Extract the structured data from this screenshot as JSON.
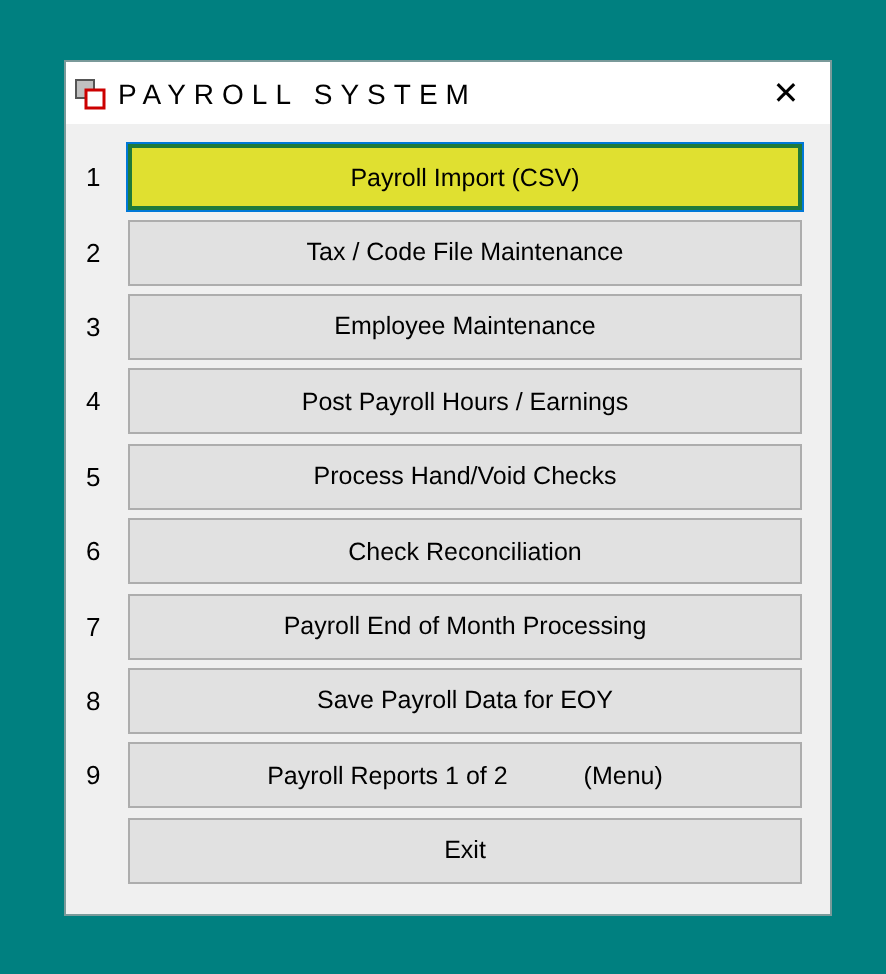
{
  "window": {
    "title": "PAYROLL SYSTEM",
    "close": "✕"
  },
  "menu_items": [
    {
      "number": "1",
      "label": "Payroll Import (CSV)",
      "selected": true
    },
    {
      "number": "2",
      "label": "Tax / Code File Maintenance",
      "selected": false
    },
    {
      "number": "3",
      "label": "Employee Maintenance",
      "selected": false
    },
    {
      "number": "4",
      "label": "Post Payroll Hours / Earnings",
      "selected": false
    },
    {
      "number": "5",
      "label": "Process Hand/Void Checks",
      "selected": false
    },
    {
      "number": "6",
      "label": "Check Reconciliation",
      "selected": false
    },
    {
      "number": "7",
      "label": "Payroll End of Month Processing",
      "selected": false
    },
    {
      "number": "8",
      "label": "Save Payroll Data for EOY",
      "selected": false
    },
    {
      "number": "9",
      "label": "Payroll Reports 1 of 2",
      "suffix": "(Menu)",
      "selected": false
    },
    {
      "label": "Exit",
      "selected": false
    }
  ]
}
